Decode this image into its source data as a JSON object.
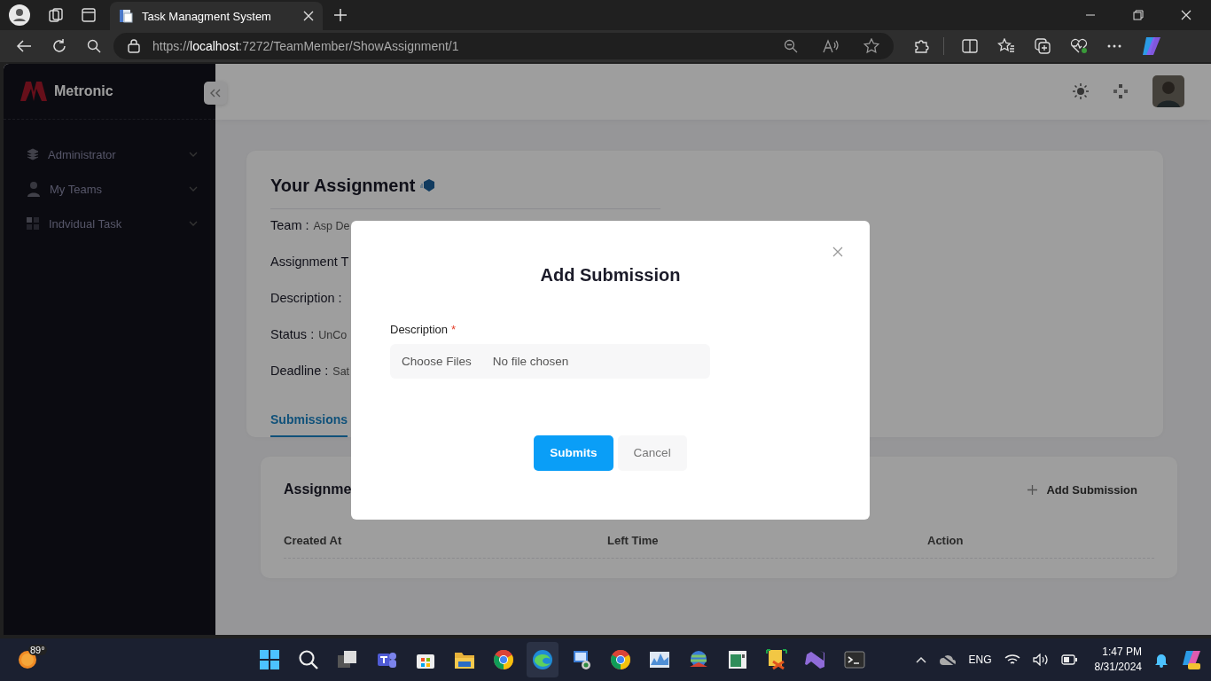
{
  "browser": {
    "tab_title": "Task Managment System",
    "url_scheme": "https://",
    "url_host": "localhost",
    "url_rest": ":7272/TeamMember/ShowAssignment/1"
  },
  "sidebar": {
    "brand": "Metronic",
    "items": [
      {
        "label": "Administrator"
      },
      {
        "label": "My Teams"
      },
      {
        "label": "Indvidual Task"
      }
    ]
  },
  "assignment": {
    "title": "Your Assignment",
    "fields": [
      {
        "label": "Team :",
        "value": "Asp De"
      },
      {
        "label": "Assignment T"
      },
      {
        "label": "Description :"
      },
      {
        "label": "Status :",
        "value": "UnCo"
      },
      {
        "label": "Deadline :",
        "value": "Sat"
      }
    ],
    "tabs": [
      {
        "label": "Submissions",
        "selected": true
      }
    ]
  },
  "submissions": {
    "title": "Assignme",
    "add_button": "Add Submission",
    "columns": [
      "Created At",
      "Left Time",
      "Action"
    ]
  },
  "modal": {
    "title": "Add Submission",
    "field_label": "Description",
    "required_mark": "*",
    "file_button": "Choose Files",
    "file_status": "No file chosen",
    "buttons": [
      {
        "label": "Submits",
        "kind": "primary"
      },
      {
        "label": "Cancel",
        "kind": "secondary"
      }
    ]
  },
  "taskbar": {
    "weather": "89°",
    "language": "ENG",
    "time": "1:47 PM",
    "date": "8/31/2024"
  }
}
